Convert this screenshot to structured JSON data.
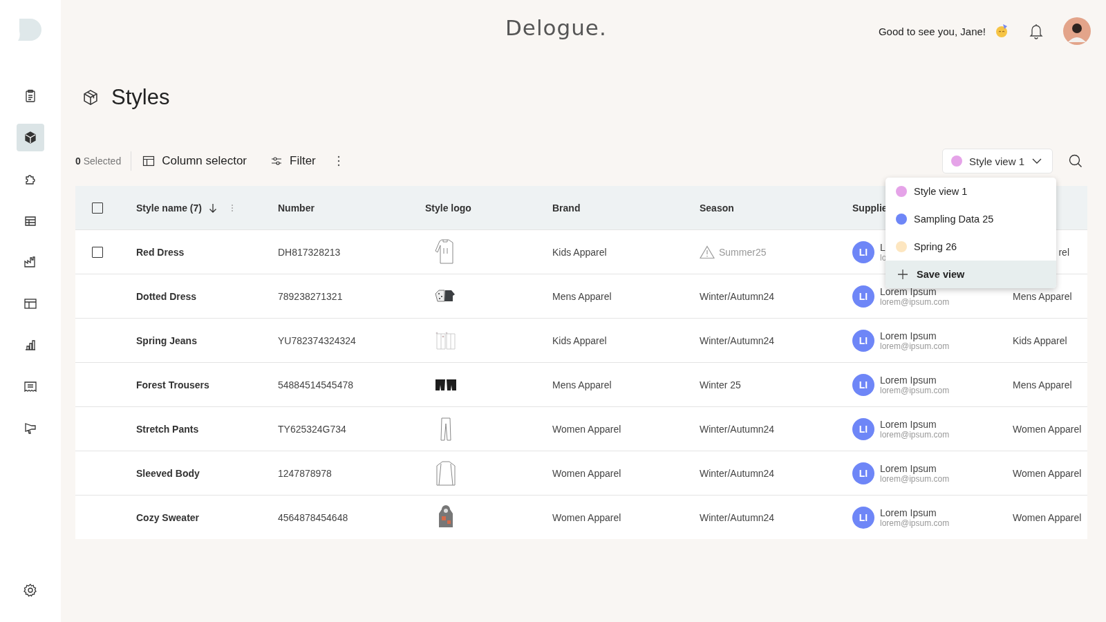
{
  "brand": "Delogue.",
  "greeting": "Good to see you, Jane!",
  "sidebar": {
    "items": [
      {
        "selected": false
      },
      {
        "selected": true
      },
      {
        "selected": false
      },
      {
        "selected": false
      },
      {
        "selected": false
      },
      {
        "selected": false
      },
      {
        "selected": false
      },
      {
        "selected": false
      },
      {
        "selected": false
      }
    ]
  },
  "page_title": "Styles",
  "toolbar": {
    "selected_count": "**0** Selected",
    "column_selector": "Column selector",
    "filter": "Filter"
  },
  "view_select": {
    "value": "Style view 1",
    "color": "#e5a3e8"
  },
  "view_menu": {
    "items": [
      {
        "label": "Style view 1",
        "color": "#e5a3e8"
      },
      {
        "label": "Sampling Data 25",
        "color": "#6e86f7"
      },
      {
        "label": "Spring 26",
        "color": "#fde6c0"
      }
    ],
    "save_view": {
      "label": "Save view",
      "highlighted": true
    }
  },
  "table": {
    "columns": [
      "Style name (7)",
      "Number",
      "Style logo",
      "Brand",
      "Season",
      "Supplie"
    ],
    "select_all": {
      "checked": false
    },
    "rows": [
      {
        "hovered": true,
        "checked": false,
        "style_name": "Red Dress",
        "number": "DH817328213",
        "brand": "Kids Apparel",
        "season": "Summer25",
        "season_warning": true,
        "supplier": {
          "initials": "LI",
          "name": "L",
          "email": "lo"
        },
        "column_7": "rel"
      },
      {
        "hovered": false,
        "checked": false,
        "style_name": "Dotted Dress",
        "number": "789238271321",
        "brand": "Mens Apparel",
        "season": "Winter/Autumn24",
        "season_warning": false,
        "supplier": {
          "initials": "LI",
          "name": "Lorem Ipsum",
          "email": "lorem@ipsum.com"
        },
        "column_7": "Mens Apparel"
      },
      {
        "hovered": false,
        "checked": false,
        "style_name": "Spring Jeans",
        "number": "YU782374324324",
        "brand": "Kids Apparel",
        "season": "Winter/Autumn24",
        "season_warning": false,
        "supplier": {
          "initials": "LI",
          "name": "Lorem Ipsum",
          "email": "lorem@ipsum.com"
        },
        "column_7": "Kids Apparel"
      },
      {
        "hovered": false,
        "checked": false,
        "style_name": "Forest Trousers",
        "number": "54884514545478",
        "brand": "Mens Apparel",
        "season": "Winter 25",
        "season_warning": false,
        "supplier": {
          "initials": "LI",
          "name": "Lorem Ipsum",
          "email": "lorem@ipsum.com"
        },
        "column_7": "Mens Apparel"
      },
      {
        "hovered": false,
        "checked": false,
        "style_name": "Stretch Pants",
        "number": "TY625324G734",
        "brand": "Women Apparel",
        "season": "Winter/Autumn24",
        "season_warning": false,
        "supplier": {
          "initials": "LI",
          "name": "Lorem Ipsum",
          "email": "lorem@ipsum.com"
        },
        "column_7": "Women Apparel"
      },
      {
        "hovered": false,
        "checked": false,
        "style_name": "Sleeved Body",
        "number": "1247878978",
        "brand": "Women Apparel",
        "season": "Winter/Autumn24",
        "season_warning": false,
        "supplier": {
          "initials": "LI",
          "name": "Lorem Ipsum",
          "email": "lorem@ipsum.com"
        },
        "column_7": "Women Apparel"
      },
      {
        "hovered": false,
        "checked": false,
        "style_name": "Cozy Sweater",
        "number": "4564878454648",
        "brand": "Women Apparel",
        "season": "Winter/Autumn24",
        "season_warning": false,
        "supplier": {
          "initials": "LI",
          "name": "Lorem Ipsum",
          "email": "lorem@ipsum.com"
        },
        "column_7": "Women Apparel"
      }
    ]
  }
}
